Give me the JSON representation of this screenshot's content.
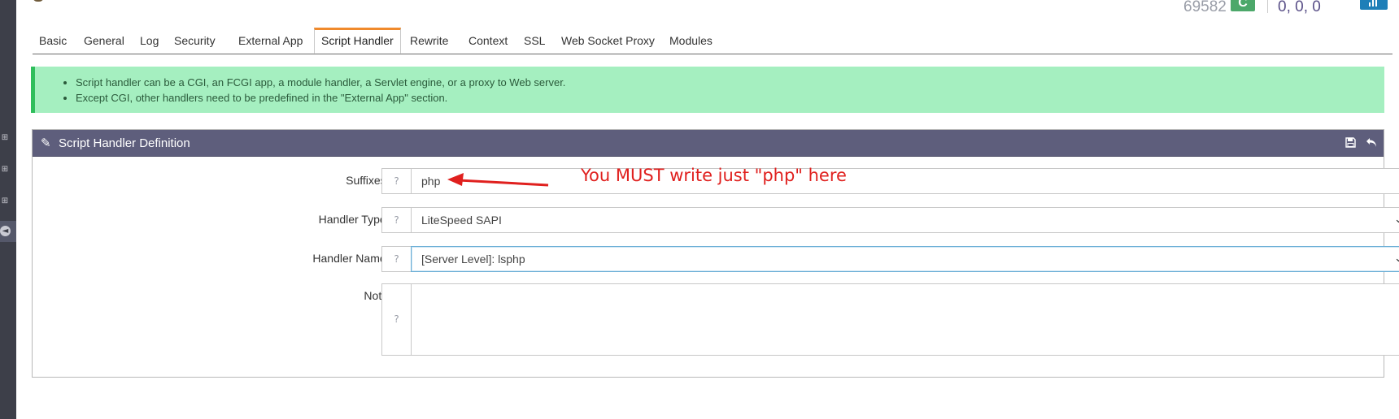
{
  "header": {
    "count": "69582",
    "badge": "C",
    "load": "0, 0, 0"
  },
  "tabs": [
    {
      "label": "Basic"
    },
    {
      "label": "General"
    },
    {
      "label": "Log"
    },
    {
      "label": "Security"
    },
    {
      "label": "External App"
    },
    {
      "label": "Script Handler",
      "active": true
    },
    {
      "label": "Rewrite"
    },
    {
      "label": "Context"
    },
    {
      "label": "SSL"
    },
    {
      "label": "Web Socket Proxy"
    },
    {
      "label": "Modules"
    }
  ],
  "info": {
    "items": [
      "Script handler can be a CGI, an FCGI app, a module handler, a Servlet engine, or a proxy to Web server.",
      "Except CGI, other handlers need to be predefined in the \"External App\" section."
    ]
  },
  "panel": {
    "title": "Script Handler Definition",
    "title_icon": "edit-icon",
    "save_icon": "save-icon",
    "undo_icon": "undo-icon",
    "fields": {
      "suffixes": {
        "label": "Suffixes *",
        "value": "php"
      },
      "handler_type": {
        "label": "Handler Type *",
        "value": "LiteSpeed SAPI"
      },
      "handler_name": {
        "label": "Handler Name *",
        "value": "[Server Level]: lsphp"
      },
      "notes": {
        "label": "Notes",
        "value": ""
      }
    }
  },
  "annotation": {
    "text": "You MUST write just \"php\" here",
    "color": "#e0201e"
  },
  "colors": {
    "panel_header": "#5e5e7c",
    "info_bg": "#a5efc0",
    "info_border": "#2fbe5c",
    "active_tab_accent": "#f08a2c",
    "sidebar": "#3d3f49"
  }
}
